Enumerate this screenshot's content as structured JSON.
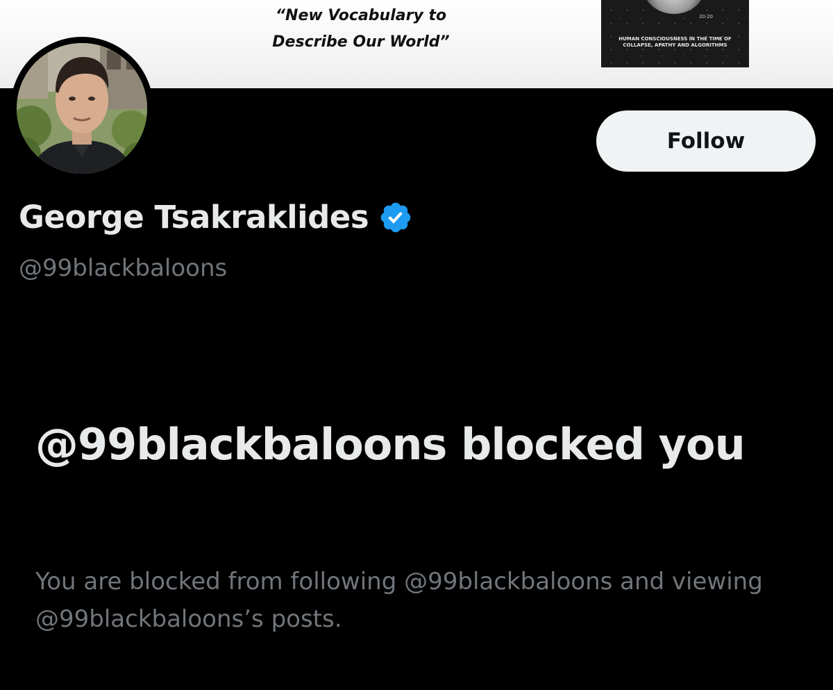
{
  "banner": {
    "quote_line1": "“New Vocabulary to",
    "quote_line2": "Describe Our World”",
    "book_edition": "20·20",
    "book_subtitle_line1": "HUMAN CONSCIOUSNESS IN THE TIME OF",
    "book_subtitle_line2": "COLLAPSE, APATHY AND ALGORITHMS"
  },
  "profile": {
    "display_name": "George Tsakraklides",
    "handle": "@99blackbaloons",
    "verified_color": "#1d9bf0"
  },
  "actions": {
    "follow_label": "Follow"
  },
  "blocked": {
    "title": "@99blackbaloons blocked you",
    "description": "You are blocked from following @99blackbaloons and viewing @99blackbaloons’s posts."
  },
  "colors": {
    "background": "#000000",
    "primary_text": "#e7e9ea",
    "secondary_text": "#71767b",
    "button_bg": "#eff3f4",
    "button_text": "#0f1419"
  }
}
